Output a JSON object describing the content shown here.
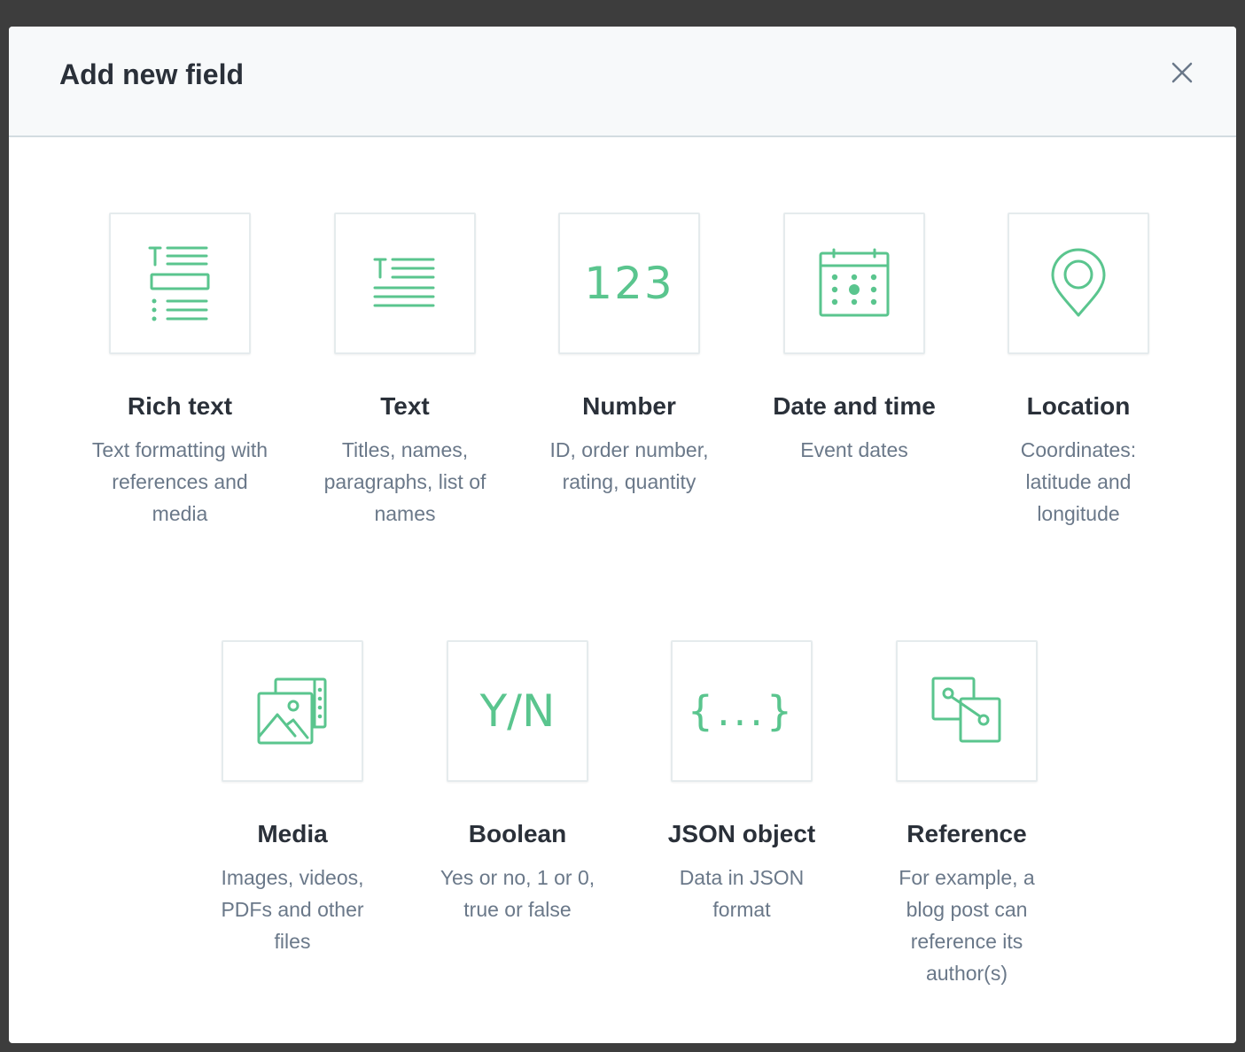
{
  "modal": {
    "title": "Add new field",
    "close_icon": "close-icon"
  },
  "colors": {
    "accent": "#5ac58e",
    "title": "#2a3039",
    "description": "#6a7889",
    "border": "#e5ebed",
    "header_bg": "#f7f9fa"
  },
  "fields": [
    {
      "icon": "rich-text-icon",
      "name": "Rich text",
      "description": "Text formatting with references and media"
    },
    {
      "icon": "text-icon",
      "name": "Text",
      "description": "Titles, names, paragraphs, list of names"
    },
    {
      "icon": "number-icon",
      "icon_text": "123",
      "name": "Number",
      "description": "ID, order number, rating, quantity"
    },
    {
      "icon": "calendar-icon",
      "name": "Date and time",
      "description": "Event dates"
    },
    {
      "icon": "location-pin-icon",
      "name": "Location",
      "description": "Coordinates: latitude and longitude"
    },
    {
      "icon": "media-icon",
      "name": "Media",
      "description": "Images, videos, PDFs and other files"
    },
    {
      "icon": "boolean-icon",
      "icon_text": "Y/N",
      "name": "Boolean",
      "description": "Yes or no, 1 or 0, true or false"
    },
    {
      "icon": "json-icon",
      "icon_text": "{...}",
      "name": "JSON object",
      "description": "Data in JSON format"
    },
    {
      "icon": "reference-icon",
      "name": "Reference",
      "description": "For example, a blog post can reference its author(s)"
    }
  ]
}
